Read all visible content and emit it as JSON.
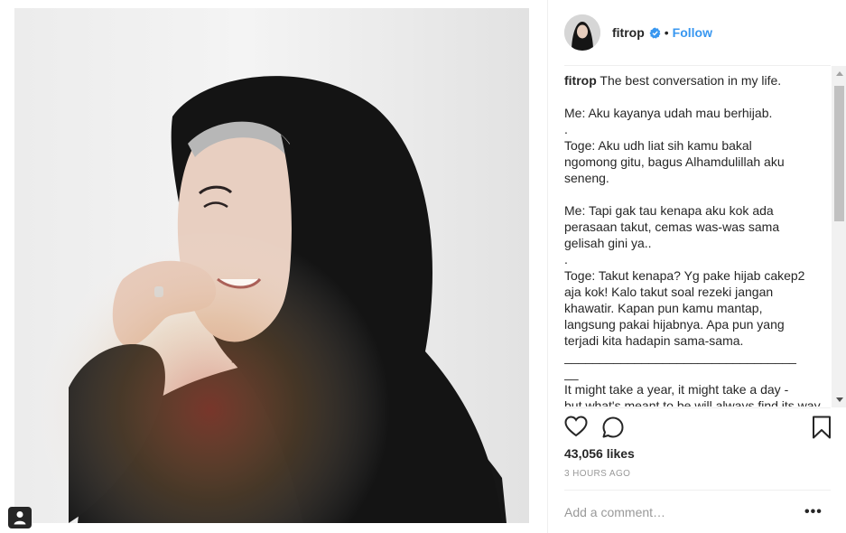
{
  "post": {
    "username": "fitrop",
    "follow_label": "Follow",
    "separator": "•",
    "caption_lines": [
      "The best conversation in my life.",
      "",
      "Me: Aku kayanya udah mau berhijab.",
      ".",
      "Toge: Aku udh liat sih kamu bakal",
      "ngomong gitu, bagus Alhamdulillah aku",
      "seneng.",
      "",
      "Me: Tapi gak tau kenapa aku kok ada",
      "perasaan takut, cemas was-was sama",
      "gelisah gini ya..",
      ".",
      "Toge: Takut kenapa? Yg pake hijab cakep2",
      "aja kok! Kalo takut soal rezeki jangan",
      "khawatir. Kapan pun kamu mantap,",
      "langsung pakai hijabnya. Apa pun yang",
      "terjadi kita hadapin sama-sama.",
      "_________________________________",
      "__",
      "It might take a year, it might take a day -",
      "but what's meant to be will always find its way."
    ],
    "likes": "43,056 likes",
    "time": "3 HOURS AGO",
    "comment_placeholder": "Add a comment…",
    "more": "•••"
  },
  "icons": {
    "verified": "verified-badge-icon",
    "like": "heart-icon",
    "comment": "comment-icon",
    "save": "bookmark-icon",
    "user_tag": "user-tag-icon"
  },
  "colors": {
    "accent": "#3897f0",
    "text": "#262626",
    "muted": "#999999",
    "hijab": "#141414"
  }
}
